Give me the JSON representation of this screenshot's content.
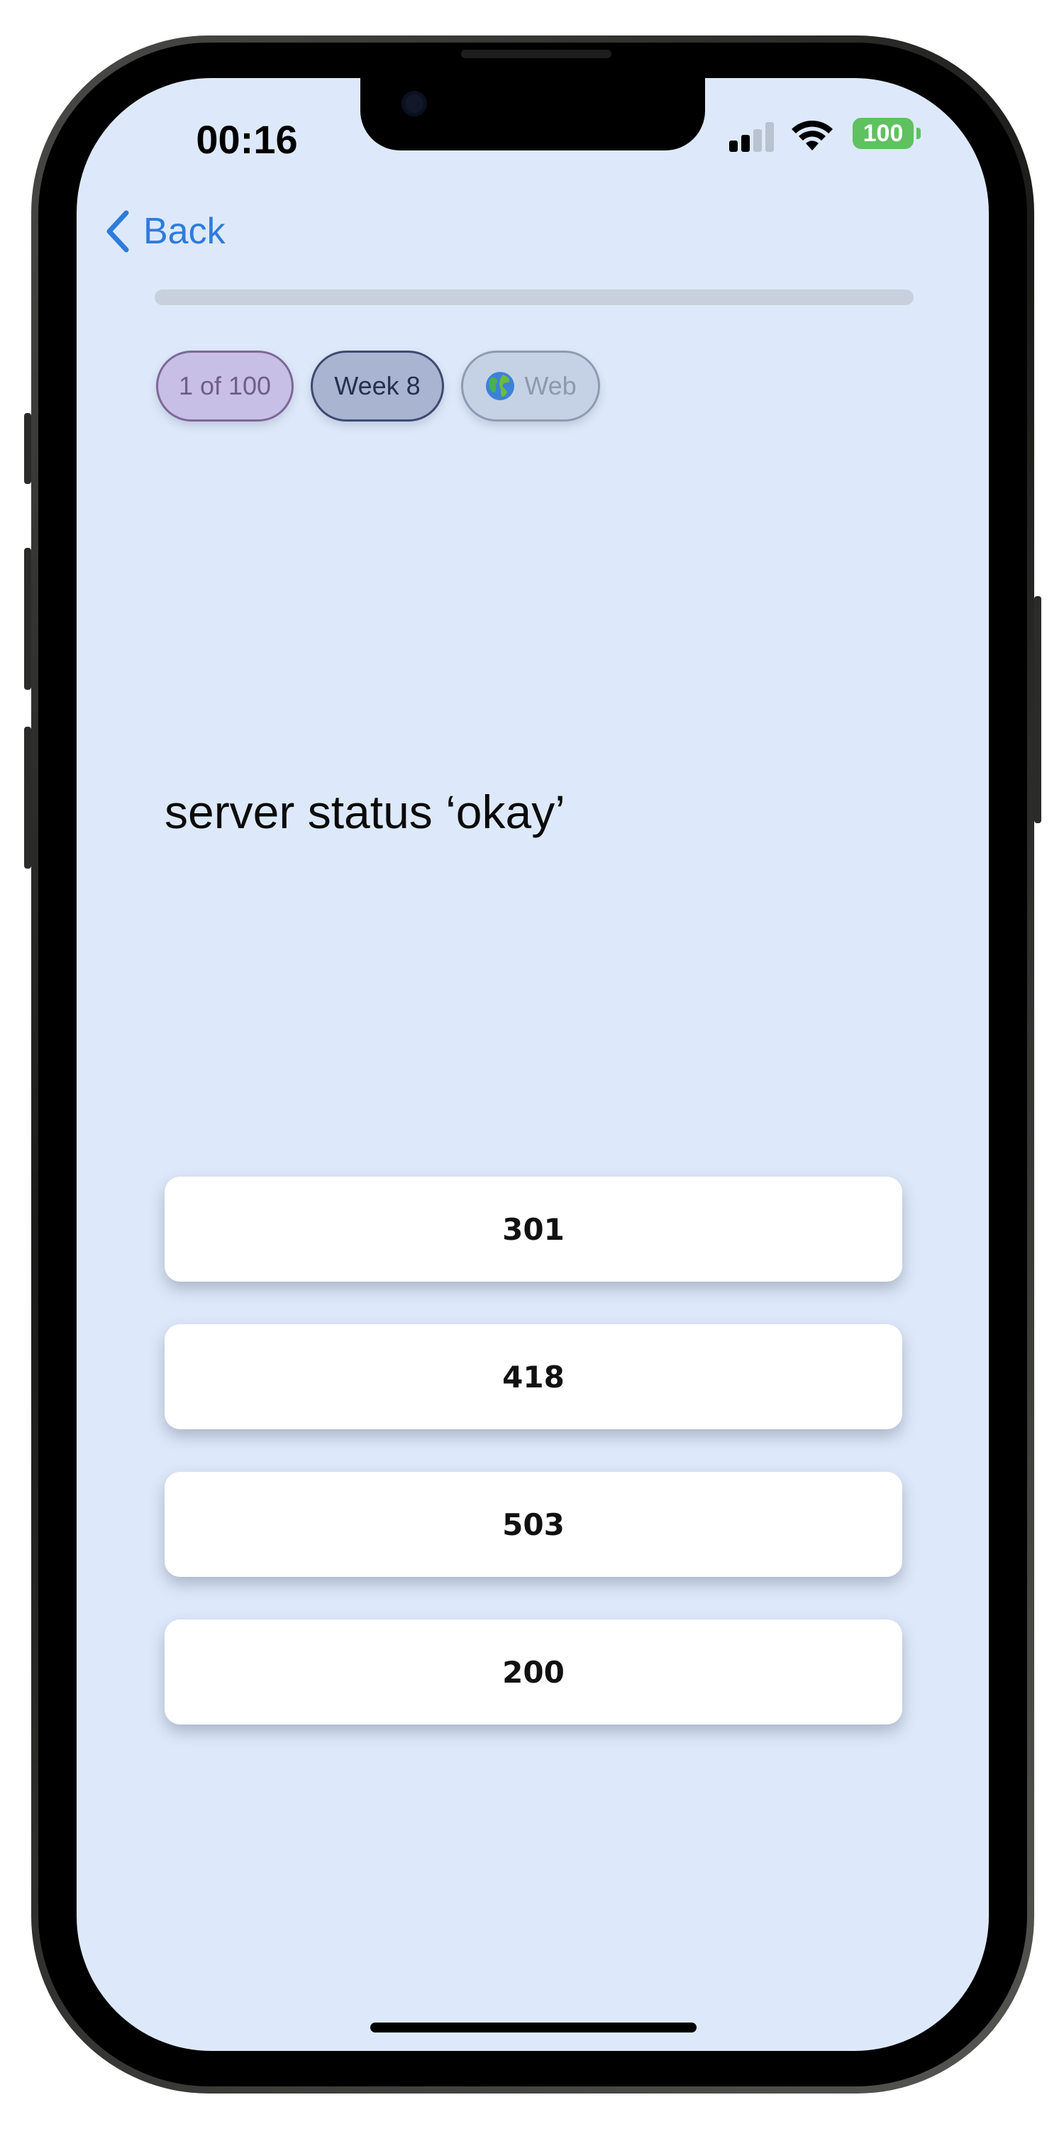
{
  "status_bar": {
    "time": "00:16",
    "battery": "100",
    "battery_color": "#5fc15f"
  },
  "nav": {
    "back_label": "Back",
    "accent_color": "#2f7bdc"
  },
  "progress": {
    "fraction": 0.0
  },
  "chips": {
    "counter": "1 of 100",
    "week": "Week 8",
    "topic": "Web",
    "topic_icon": "globe-icon"
  },
  "question": {
    "prompt": "server status ‘okay’"
  },
  "answers": [
    {
      "label": "301"
    },
    {
      "label": "418"
    },
    {
      "label": "503"
    },
    {
      "label": "200"
    }
  ]
}
